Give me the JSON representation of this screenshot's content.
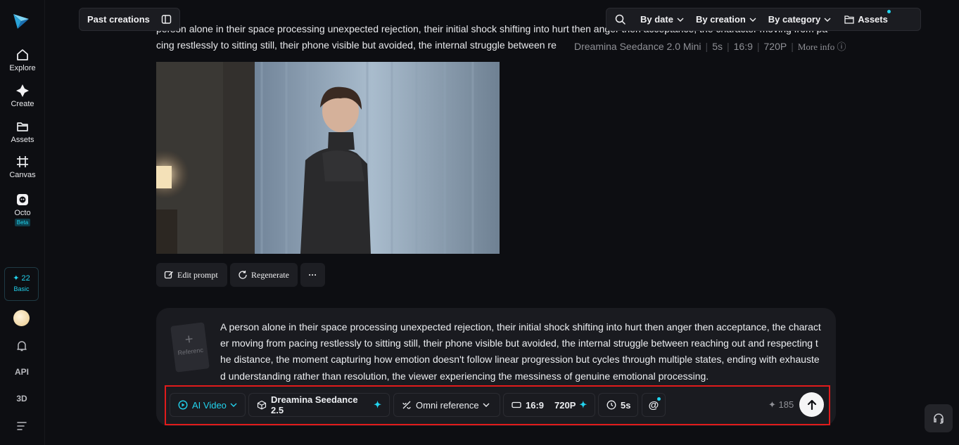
{
  "sidebar": {
    "items": [
      {
        "label": "Explore",
        "icon": "home-icon"
      },
      {
        "label": "Create",
        "icon": "sparkle-icon"
      },
      {
        "label": "Assets",
        "icon": "folder-icon"
      },
      {
        "label": "Canvas",
        "icon": "canvas-icon"
      },
      {
        "label": "Octo",
        "icon": "octo-icon",
        "badge": "Beta"
      }
    ],
    "credits": {
      "count": "22",
      "plan": "Basic"
    },
    "api_label": "API",
    "threed_label": "3D"
  },
  "header": {
    "past_creations": "Past creations",
    "filters": [
      "By date",
      "By creation",
      "By category"
    ],
    "assets_label": "Assets"
  },
  "generation": {
    "prompt_line1": " person alone in their space processing unexpected rejection, their initial shock shifting into hurt then anger then acceptance, the character moving from pa",
    "prompt_line2": "cing restlessly to sitting still, their phone visible but avoided, the internal struggle between re",
    "model": "Dreamina Seedance 2.0 Mini",
    "duration": "5s",
    "ratio": "16:9",
    "resolution": "720P",
    "more_info": "More info",
    "actions": {
      "edit": "Edit prompt",
      "regenerate": "Regenerate",
      "more": "···"
    }
  },
  "composer": {
    "reference_label": "Referenc",
    "prompt_text": "A person alone in their space processing unexpected rejection, their initial shock shifting into hurt then anger then acceptance, the character moving from pacing restlessly to sitting still, their phone visible but avoided, the internal struggle between reaching out and respecting the distance, the moment capturing how emotion doesn't follow linear progression but cycles through multiple states, ending with exhausted understanding rather than resolution, the viewer experiencing the messiness of genuine emotional processing.",
    "mode": "AI Video",
    "model": "Dreamina Seedance 2.5",
    "reference_mode": "Omni reference",
    "ratio": "16:9",
    "resolution": "720P",
    "duration": "5s",
    "mention": "@",
    "cost": "185"
  },
  "colors": {
    "accent": "#22d3ee",
    "highlight_border": "#e01b1b",
    "background": "#0d0e12"
  }
}
